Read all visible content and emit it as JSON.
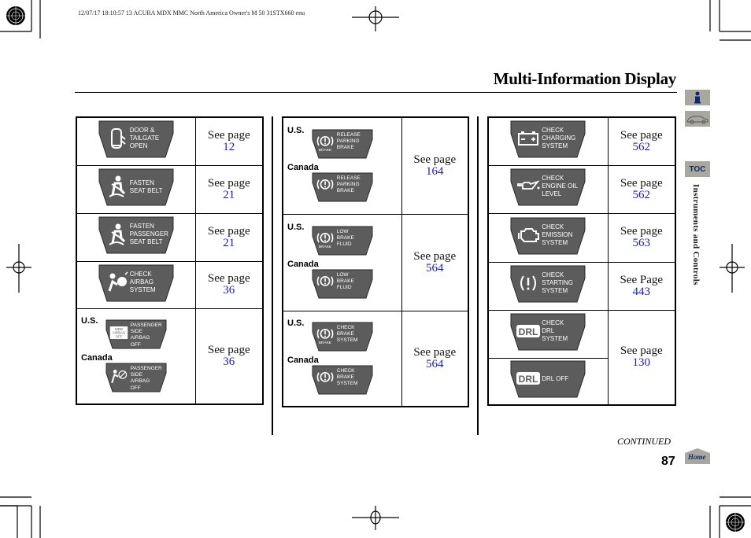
{
  "print_header": "12/07/17 18:10:57   13 ACURA MDX MMC North America Owner's M 50 31STX660 enu",
  "page_title": "Multi-Information Display",
  "side_nav": {
    "info_icon": "info-icon",
    "vehicle_icon": "car-icon",
    "toc_label": "TOC",
    "section_label": "Instruments and Controls",
    "home_label": "Home"
  },
  "colors": {
    "message_bg": "#5c5c5c",
    "page_link": "#1a1acc",
    "side_tab": "#a8a8a0",
    "nav_text": "#0c2a6b"
  },
  "tables": [
    {
      "rows": [
        {
          "messages": [
            {
              "region": "",
              "icon": "door-tailgate-icon",
              "lines": [
                "DOOR &",
                "TAILGATE",
                "OPEN"
              ]
            }
          ],
          "see": "See page",
          "page": "12"
        },
        {
          "messages": [
            {
              "region": "",
              "icon": "seat-belt-icon",
              "lines": [
                "FASTEN",
                "SEAT BELT"
              ]
            }
          ],
          "see": "See page",
          "page": "21"
        },
        {
          "messages": [
            {
              "region": "",
              "icon": "seat-belt-icon",
              "lines": [
                "FASTEN",
                "PASSENGER",
                "SEAT BELT"
              ]
            }
          ],
          "see": "See page",
          "page": "21"
        },
        {
          "messages": [
            {
              "region": "",
              "icon": "airbag-icon",
              "lines": [
                "CHECK",
                "AIRBAG",
                "SYSTEM"
              ]
            }
          ],
          "see": "See page",
          "page": "36"
        },
        {
          "messages": [
            {
              "region": "U.S.",
              "icon": "side-airbag-off-icon",
              "icon_text": [
                "SIDE",
                "AIRBAG",
                "OFF"
              ],
              "lines": [
                "PASSENGER",
                "SIDE",
                "AIRBAG",
                "OFF"
              ]
            },
            {
              "region": "Canada",
              "icon": "passenger-airbag-off-icon",
              "lines": [
                "PASSENGER",
                "SIDE",
                "AIRBAG",
                "OFF"
              ]
            }
          ],
          "see": "See page",
          "page": "36"
        }
      ]
    },
    {
      "rows": [
        {
          "messages": [
            {
              "region": "U.S.",
              "icon": "brake-warning-icon",
              "icon_text": [
                "BRAKE"
              ],
              "lines": [
                "RELEASE",
                "PARKING",
                "BRAKE"
              ]
            },
            {
              "region": "Canada",
              "icon": "brake-warning-icon",
              "lines": [
                "RELEASE",
                "PARKING",
                "BRAKE"
              ]
            }
          ],
          "see": "See page",
          "page": "164"
        },
        {
          "messages": [
            {
              "region": "U.S.",
              "icon": "brake-warning-icon",
              "icon_text": [
                "BRAKE"
              ],
              "lines": [
                "LOW",
                "BRAKE",
                "FLUID"
              ]
            },
            {
              "region": "Canada",
              "icon": "brake-warning-icon",
              "lines": [
                "LOW",
                "BRAKE",
                "FLUID"
              ]
            }
          ],
          "see": "See page",
          "page": "564"
        },
        {
          "messages": [
            {
              "region": "U.S.",
              "icon": "brake-warning-icon",
              "icon_text": [
                "BRAKE"
              ],
              "lines": [
                "CHECK",
                "BRAKE",
                "SYSTEM"
              ]
            },
            {
              "region": "Canada",
              "icon": "brake-warning-icon",
              "lines": [
                "CHECK",
                "BRAKE",
                "SYSTEM"
              ]
            }
          ],
          "see": "See page",
          "page": "564"
        }
      ]
    },
    {
      "rows": [
        {
          "messages": [
            {
              "region": "",
              "icon": "battery-icon",
              "lines": [
                "CHECK",
                "CHARGING",
                "SYSTEM"
              ]
            }
          ],
          "see": "See page",
          "page": "562"
        },
        {
          "messages": [
            {
              "region": "",
              "icon": "oil-can-icon",
              "lines": [
                "CHECK",
                "ENGINE OIL",
                "LEVEL"
              ]
            }
          ],
          "see": "See page",
          "page": "562"
        },
        {
          "messages": [
            {
              "region": "",
              "icon": "check-engine-icon",
              "lines": [
                "CHECK",
                "EMISSION",
                "SYSTEM"
              ]
            }
          ],
          "see": "See page",
          "page": "563"
        },
        {
          "messages": [
            {
              "region": "",
              "icon": "starting-system-icon",
              "lines": [
                "CHECK",
                "STARTING",
                "SYSTEM"
              ]
            }
          ],
          "see": "See Page",
          "page": "443"
        },
        {
          "messages": [
            {
              "region": "",
              "icon": "drl-icon",
              "icon_text": [
                "DRL"
              ],
              "lines": [
                "CHECK",
                "DRL",
                "SYSTEM"
              ]
            }
          ],
          "see": "See page",
          "page": "130"
        },
        {
          "messages": [
            {
              "region": "",
              "icon": "drl-icon",
              "icon_text": [
                "DRL"
              ],
              "lines": [
                "DRL OFF"
              ]
            }
          ],
          "see": "",
          "page": ""
        }
      ]
    }
  ],
  "footer": {
    "continued": "CONTINUED",
    "page_number": "87"
  }
}
